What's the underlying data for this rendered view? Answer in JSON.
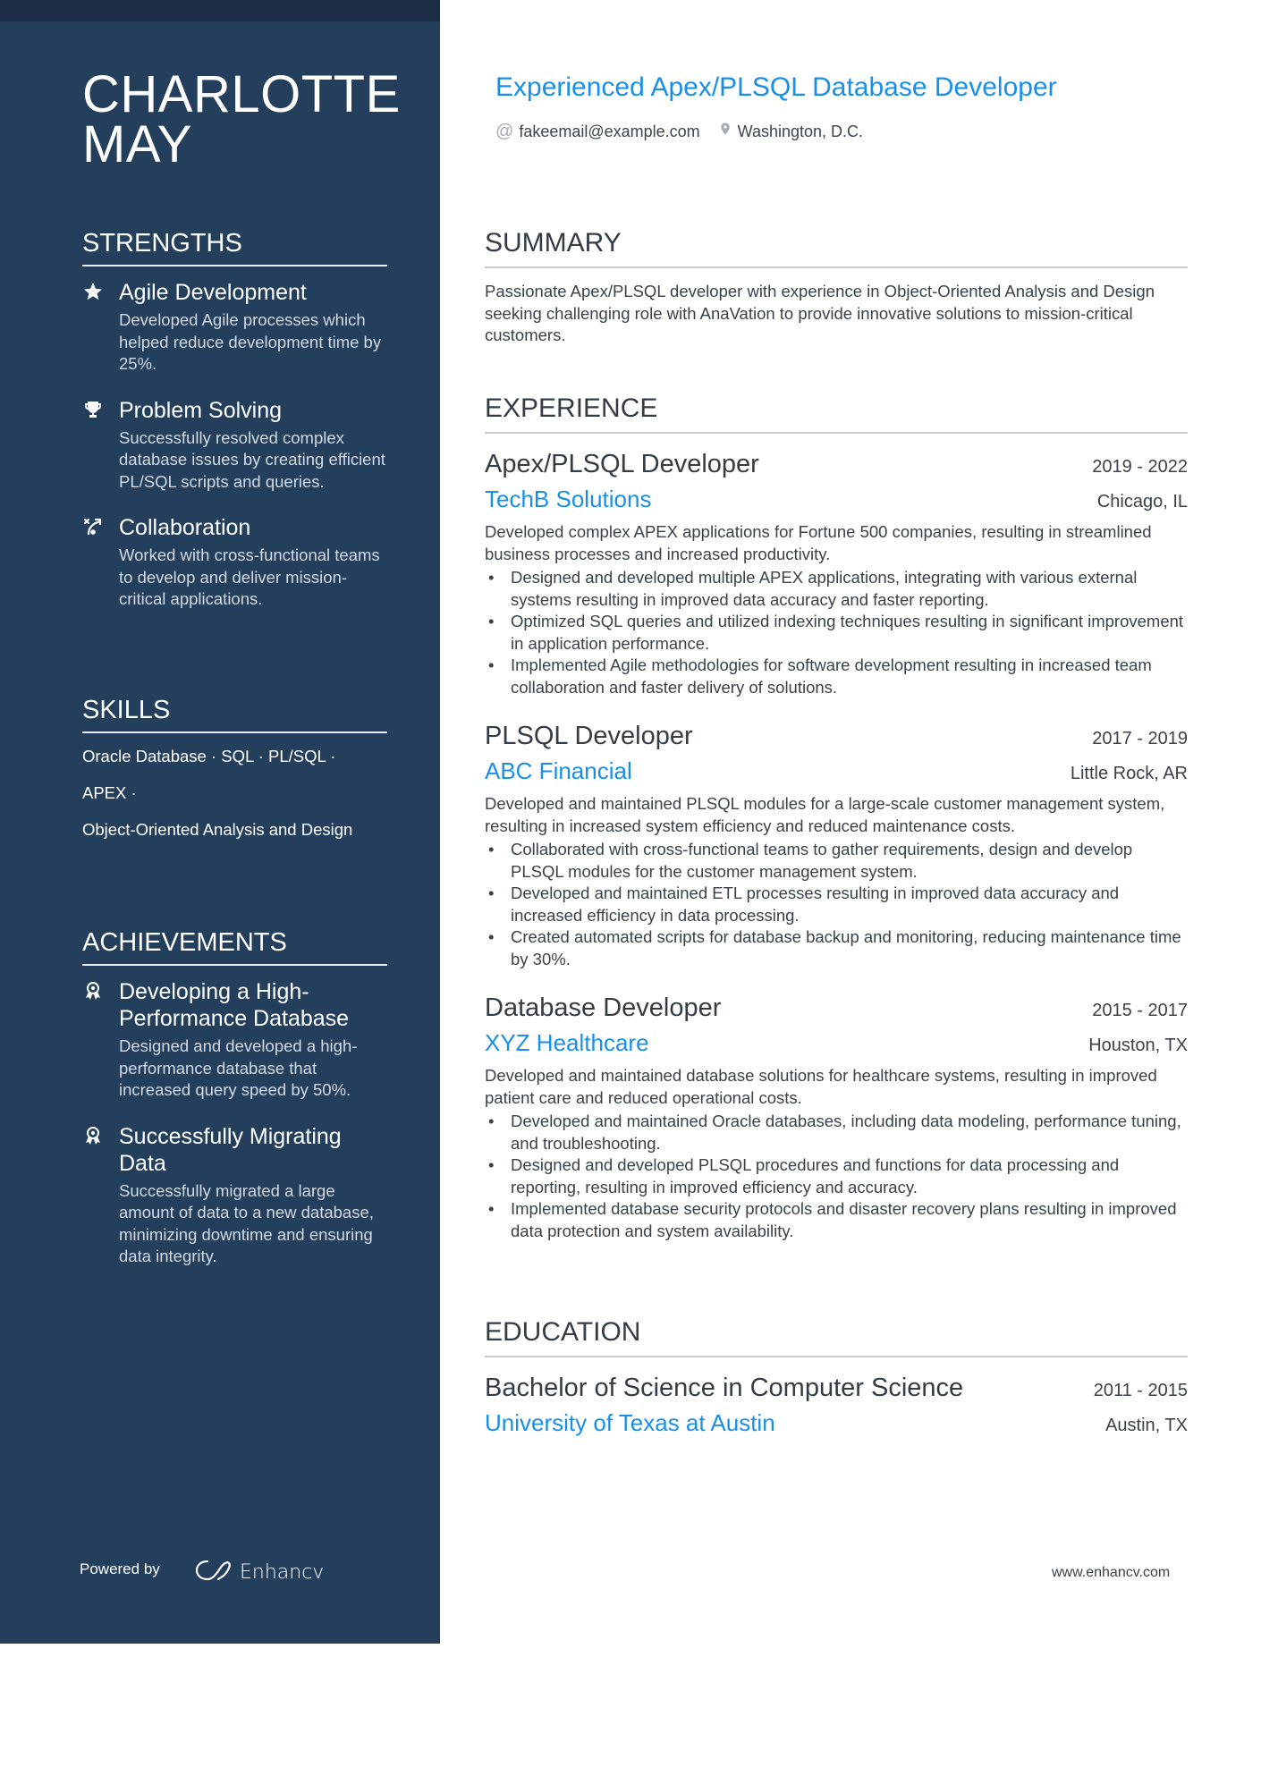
{
  "name": "CHARLOTTE MAY",
  "headline": "Experienced Apex/PLSQL Database Developer",
  "contact": {
    "email_icon": "at-icon",
    "email": "fakeemail@example.com",
    "location_icon": "map-pin-icon",
    "location": "Washington, D.C."
  },
  "sidebar": {
    "strengths": {
      "heading": "STRENGTHS",
      "items": [
        {
          "icon": "star-icon",
          "title": "Agile Development",
          "desc": "Developed Agile processes which helped reduce development time by 25%."
        },
        {
          "icon": "trophy-icon",
          "title": "Problem Solving",
          "desc": "Successfully resolved complex database issues by creating efficient PL/SQL scripts and queries."
        },
        {
          "icon": "strategy-icon",
          "title": "Collaboration",
          "desc": "Worked with cross-functional teams to develop and deliver mission-critical applications."
        }
      ]
    },
    "skills": {
      "heading": "SKILLS",
      "lines": [
        "Oracle Database · SQL · PL/SQL ·",
        "APEX ·",
        "Object-Oriented Analysis and Design"
      ]
    },
    "achievements": {
      "heading": "ACHIEVEMENTS",
      "items": [
        {
          "icon": "award-icon",
          "title": "Developing a High-Performance Database",
          "desc": "Designed and developed a high-performance database that increased query speed by 50%."
        },
        {
          "icon": "award-icon",
          "title": "Successfully Migrating Data",
          "desc": "Successfully migrated a large amount of data to a new database, minimizing downtime and ensuring data integrity."
        }
      ]
    },
    "powered_by": "Powered by",
    "brand": "Enhancv"
  },
  "summary": {
    "heading": "SUMMARY",
    "text": "Passionate Apex/PLSQL developer with experience in Object-Oriented Analysis and Design seeking challenging role with AnaVation to provide innovative solutions to mission-critical customers."
  },
  "experience": {
    "heading": "EXPERIENCE",
    "jobs": [
      {
        "title": "Apex/PLSQL Developer",
        "dates": "2019 - 2022",
        "company": "TechB Solutions",
        "location": "Chicago, IL",
        "desc": "Developed complex APEX applications for Fortune 500 companies, resulting in streamlined business processes and increased productivity.",
        "bullets": [
          "Designed and developed multiple APEX applications, integrating with various external systems resulting in improved data accuracy and faster reporting.",
          "Optimized SQL queries and utilized indexing techniques resulting in significant improvement in application performance.",
          "Implemented Agile methodologies for software development resulting in increased team collaboration and faster delivery of solutions."
        ]
      },
      {
        "title": "PLSQL Developer",
        "dates": "2017 - 2019",
        "company": "ABC Financial",
        "location": "Little Rock, AR",
        "desc": "Developed and maintained PLSQL modules for a large-scale customer management system, resulting in increased system efficiency and reduced maintenance costs.",
        "bullets": [
          "Collaborated with cross-functional teams to gather requirements, design and develop PLSQL modules for the customer management system.",
          "Developed and maintained ETL processes resulting in improved data accuracy and increased efficiency in data processing.",
          "Created automated scripts for database backup and monitoring, reducing maintenance time by 30%."
        ]
      },
      {
        "title": "Database Developer",
        "dates": "2015 - 2017",
        "company": "XYZ Healthcare",
        "location": "Houston, TX",
        "desc": "Developed and maintained database solutions for healthcare systems, resulting in improved patient care and reduced operational costs.",
        "bullets": [
          "Developed and maintained Oracle databases, including data modeling, performance tuning, and troubleshooting.",
          "Designed and developed PLSQL procedures and functions for data processing and reporting, resulting in improved efficiency and accuracy.",
          "Implemented database security protocols and disaster recovery plans resulting in improved data protection and system availability."
        ]
      }
    ]
  },
  "education": {
    "heading": "EDUCATION",
    "degree": "Bachelor of Science in Computer Science",
    "dates": "2011 - 2015",
    "school": "University of Texas at Austin",
    "location": "Austin, TX"
  },
  "footer_url": "www.enhancv.com",
  "colors": {
    "sidebar": "#233f5c",
    "topstrip": "#1b2d45",
    "accent": "#1a8fe8",
    "text": "#39424b"
  }
}
